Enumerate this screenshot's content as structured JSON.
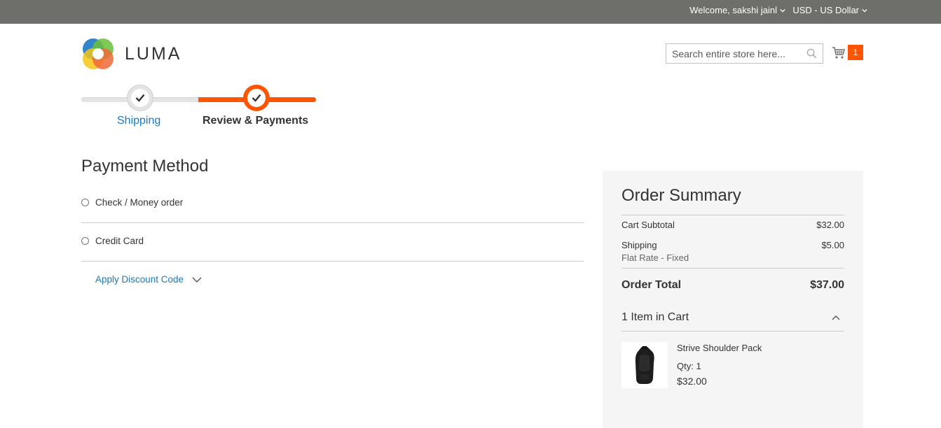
{
  "topbar": {
    "welcome": "Welcome, sakshi jainl",
    "currency": "USD - US Dollar"
  },
  "header": {
    "logo_text": "LUMA",
    "search_placeholder": "Search entire store here...",
    "cart_count": "1"
  },
  "progress": {
    "steps": [
      {
        "label": "Shipping",
        "state": "complete"
      },
      {
        "label": "Review & Payments",
        "state": "active"
      }
    ]
  },
  "payment": {
    "title": "Payment Method",
    "options": [
      {
        "label": "Check / Money order",
        "selected": false
      },
      {
        "label": "Credit Card",
        "selected": false
      }
    ],
    "discount_label": "Apply Discount Code"
  },
  "summary": {
    "title": "Order Summary",
    "subtotal_label": "Cart Subtotal",
    "subtotal_value": "$32.00",
    "shipping_label": "Shipping",
    "shipping_method": "Flat Rate - Fixed",
    "shipping_value": "$5.00",
    "total_label": "Order Total",
    "total_value": "$37.00",
    "items_in_cart": "1 Item in Cart",
    "items": [
      {
        "name": "Strive Shoulder Pack",
        "qty": "Qty: 1",
        "price": "$32.00"
      }
    ]
  },
  "colors": {
    "accent": "#ff5501",
    "link": "#1979c3",
    "topbar": "#6e6e6b",
    "summary_bg": "#f5f5f5"
  },
  "icons": [
    "chevron-down-icon",
    "search-icon",
    "cart-icon",
    "check-icon",
    "chevron-up-icon"
  ]
}
